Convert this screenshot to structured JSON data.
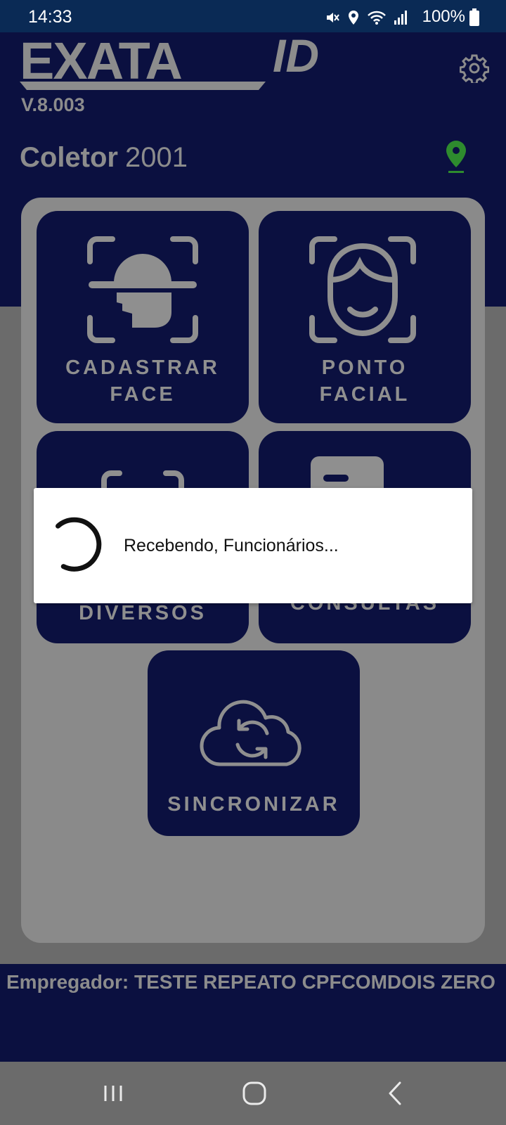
{
  "status_bar": {
    "time": "14:33",
    "battery": "100%"
  },
  "header": {
    "logo_text": "EXATA",
    "logo_suffix": "ID",
    "version": "V.8.003",
    "collector_label": "Coletor",
    "collector_value": "2001"
  },
  "tiles": {
    "register_face": {
      "line1": "CADASTRAR",
      "line2": "FACE"
    },
    "facial_point": {
      "line1": "PONTO",
      "line2": "FACIAL"
    },
    "misc": {
      "label": "DIVERSOS"
    },
    "queries": {
      "label": "CONSULTAS"
    },
    "sync": {
      "label": "SINCRONIZAR"
    }
  },
  "dialog": {
    "message": "Recebendo, Funcionários..."
  },
  "footer": {
    "employer": "Empregador: TESTE REPEATO CPFCOMDOIS ZERO"
  },
  "colors": {
    "navy": "#0b1040",
    "gray_text": "#8c8c8c",
    "location_green": "#2e8b2e"
  },
  "icons": [
    "settings-gear-icon",
    "location-pin-icon",
    "face-scan-icon",
    "face-icon",
    "cloud-sync-icon",
    "spinner-icon"
  ]
}
